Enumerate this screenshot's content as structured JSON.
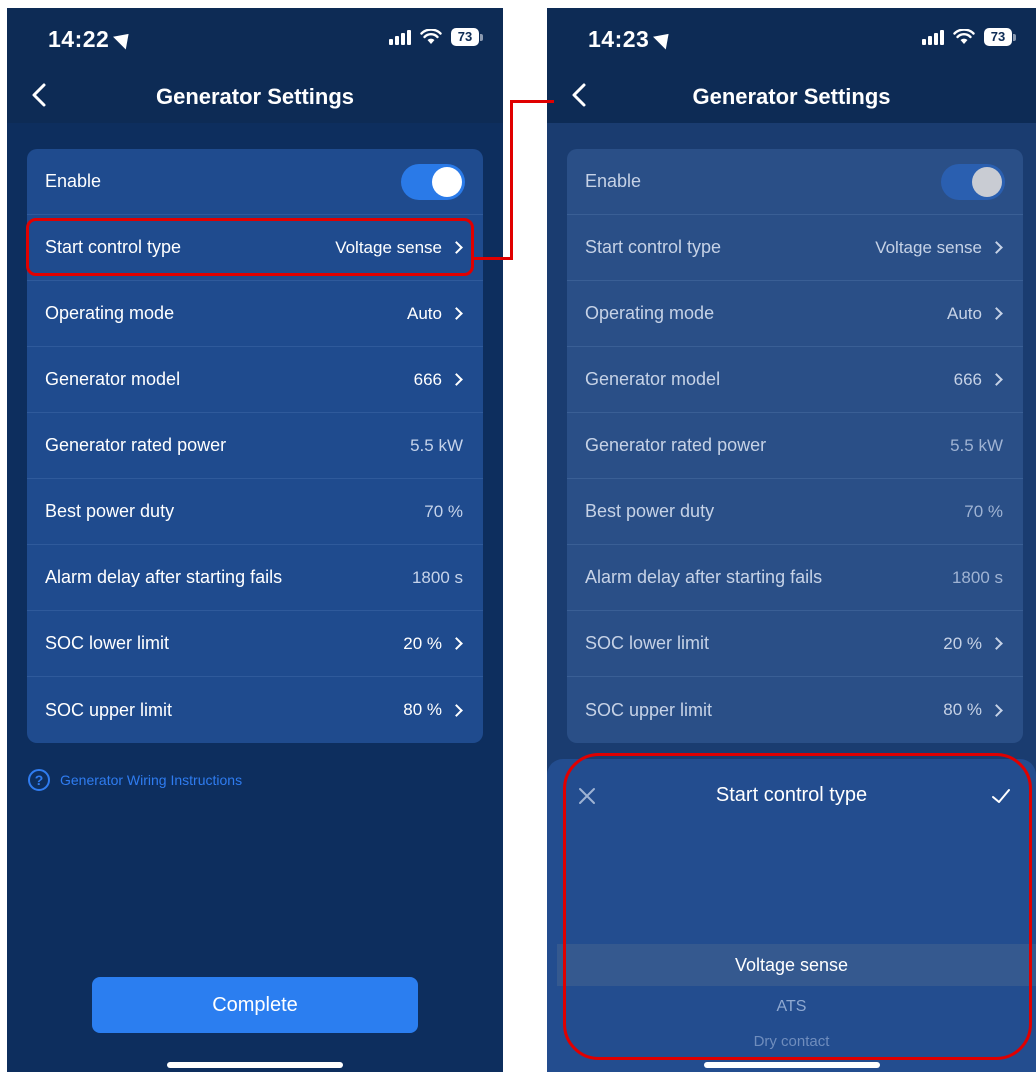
{
  "left_phone": {
    "status": {
      "time": "14:22",
      "battery": "73"
    },
    "nav": {
      "title": "Generator Settings"
    },
    "settings": [
      {
        "label": "Enable",
        "type": "toggle",
        "on": true
      },
      {
        "label": "Start control type",
        "value": "Voltage sense",
        "chevron": true
      },
      {
        "label": "Operating mode",
        "value": "Auto",
        "chevron": true
      },
      {
        "label": "Generator model",
        "value": "666",
        "chevron": true
      },
      {
        "label": "Generator rated power",
        "value": "5.5 kW",
        "chevron": false
      },
      {
        "label": "Best power duty",
        "value": "70 %",
        "chevron": false
      },
      {
        "label": "Alarm delay after starting fails",
        "value": "1800 s",
        "chevron": false
      },
      {
        "label": "SOC lower limit",
        "value": "20 %",
        "chevron": true
      },
      {
        "label": "SOC upper limit",
        "value": "80 %",
        "chevron": true
      }
    ],
    "wiring_link": "Generator Wiring Instructions",
    "help_glyph": "?",
    "complete_button": "Complete"
  },
  "right_phone": {
    "status": {
      "time": "14:23",
      "battery": "73"
    },
    "nav": {
      "title": "Generator Settings"
    },
    "settings": [
      {
        "label": "Enable",
        "type": "toggle",
        "on": true
      },
      {
        "label": "Start control type",
        "value": "Voltage sense",
        "chevron": true
      },
      {
        "label": "Operating mode",
        "value": "Auto",
        "chevron": true
      },
      {
        "label": "Generator model",
        "value": "666",
        "chevron": true
      },
      {
        "label": "Generator rated power",
        "value": "5.5 kW",
        "chevron": false
      },
      {
        "label": "Best power duty",
        "value": "70 %",
        "chevron": false
      },
      {
        "label": "Alarm delay after starting fails",
        "value": "1800 s",
        "chevron": false
      },
      {
        "label": "SOC lower limit",
        "value": "20 %",
        "chevron": true
      },
      {
        "label": "SOC upper limit",
        "value": "80 %",
        "chevron": true
      }
    ],
    "sheet": {
      "title": "Start control type",
      "options": [
        "Voltage sense",
        "ATS",
        "Dry contact"
      ],
      "selected": "Voltage sense"
    }
  },
  "colors": {
    "background": "#0d2b55",
    "card": "#1f4b8e",
    "accent": "#2b7ef0",
    "annotation": "#e00000"
  },
  "icons": [
    "location-arrow-icon",
    "cellular-signal-icon",
    "wifi-icon",
    "battery-icon",
    "back-chevron-icon",
    "chevron-right-icon",
    "help-circle-icon",
    "close-icon",
    "checkmark-icon"
  ]
}
